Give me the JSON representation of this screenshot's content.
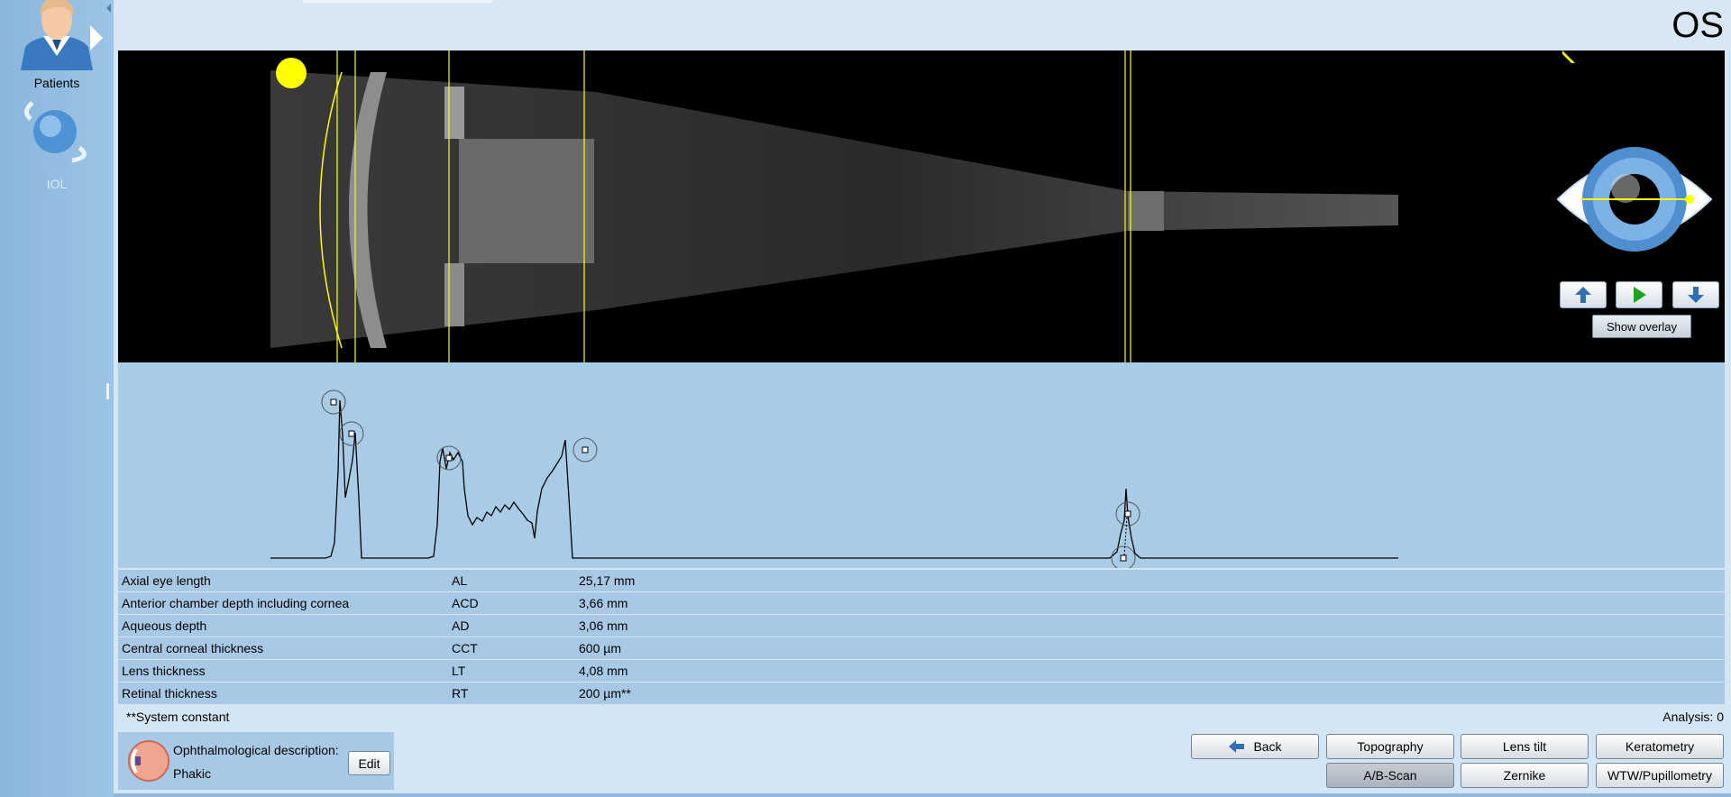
{
  "sidebar": {
    "items": [
      {
        "label": "Patients",
        "icon": "patient-avatar-icon"
      },
      {
        "label": "IOL",
        "icon": "iol-lens-icon"
      }
    ]
  },
  "header": {
    "eye_side": "OS"
  },
  "scan": {
    "nav_up_icon": "arrow-up-icon",
    "play_icon": "play-icon",
    "nav_down_icon": "arrow-down-icon",
    "show_overlay_label": "Show overlay"
  },
  "measurements": [
    {
      "name": "Axial eye length",
      "abbr": "AL",
      "value": "25,17 mm"
    },
    {
      "name": "Anterior chamber depth including cornea",
      "abbr": "ACD",
      "value": "3,66 mm"
    },
    {
      "name": "Aqueous depth",
      "abbr": "AD",
      "value": "3,06 mm"
    },
    {
      "name": "Central corneal thickness",
      "abbr": "CCT",
      "value": "600 µm"
    },
    {
      "name": "Lens thickness",
      "abbr": "LT",
      "value": "4,08 mm"
    },
    {
      "name": "Retinal thickness",
      "abbr": "RT",
      "value": "200 µm**"
    }
  ],
  "footnote": "**System constant",
  "analysis": "Analysis: 0",
  "ophthalmological": {
    "title": "Ophthalmological description:",
    "value": "Phakic",
    "edit_label": "Edit"
  },
  "nav_buttons": {
    "back": "Back",
    "topography": "Topography",
    "lens_tilt": "Lens tilt",
    "keratometry": "Keratometry",
    "ab_scan": "A/B-Scan",
    "zernike": "Zernike",
    "wtw": "WTW/Pupillometry"
  },
  "colors": {
    "marker_yellow": "#ffff00",
    "panel_blue": "#a8c9e5",
    "active_button": "#b3bcc6"
  }
}
